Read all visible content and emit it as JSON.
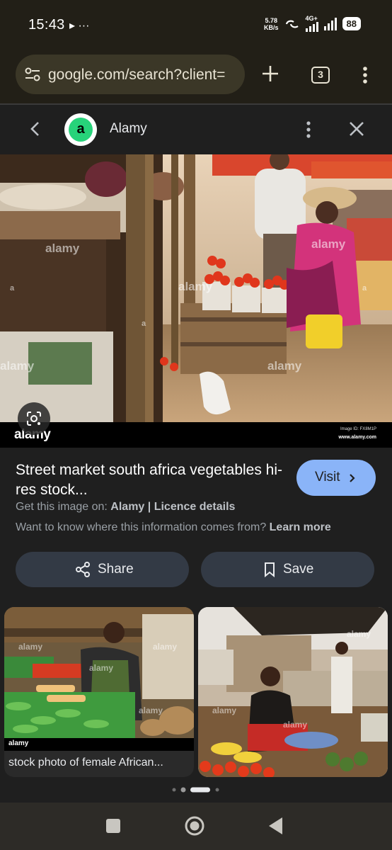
{
  "status_bar": {
    "time": "15:43",
    "left_icons": "▸ ···",
    "net_speed_value": "5.78",
    "net_speed_unit": "KB/s",
    "network": "4G+",
    "battery": "88"
  },
  "browser": {
    "url": "google.com/search?client=",
    "tab_count": "3"
  },
  "lens_header": {
    "site_logo_letter": "a",
    "site_name": "Alamy"
  },
  "hero": {
    "footer_logo": "alamy",
    "image_id": "Image ID: FX8M1P",
    "image_url": "www.alamy.com",
    "watermark": "alamy"
  },
  "result": {
    "title": "Street market south africa vegetables hi-res stock...",
    "visit_label": "Visit",
    "source_prefix": "Get this image on: ",
    "source_name": "Alamy",
    "source_sep": " | ",
    "licence_label": "Licence details",
    "info_prefix": "Want to know where this information comes from? ",
    "learn_more": "Learn more",
    "share_label": "Share",
    "save_label": "Save"
  },
  "related": [
    {
      "caption": "stock photo of female African...",
      "footer_logo": "alamy"
    },
    {
      "caption": ""
    }
  ],
  "carousel": {
    "active_index": 2,
    "count": 4
  },
  "colors": {
    "accent": "#8ab4f8",
    "chrome_bar": "#221f17",
    "url_pill": "#3b3727",
    "page_bg": "#1f1f1f",
    "button_bg": "#333a45",
    "site_logo": "#27d37a"
  },
  "icons": {
    "site_settings": "tune-icon",
    "new_tab": "plus-icon",
    "overflow": "more-vert-icon",
    "back": "chevron-left-icon",
    "close": "close-icon",
    "lens": "lens-icon",
    "share": "share-icon",
    "save": "bookmark-icon",
    "nav_recents": "square-icon",
    "nav_home": "circle-icon",
    "nav_back": "triangle-back-icon"
  }
}
